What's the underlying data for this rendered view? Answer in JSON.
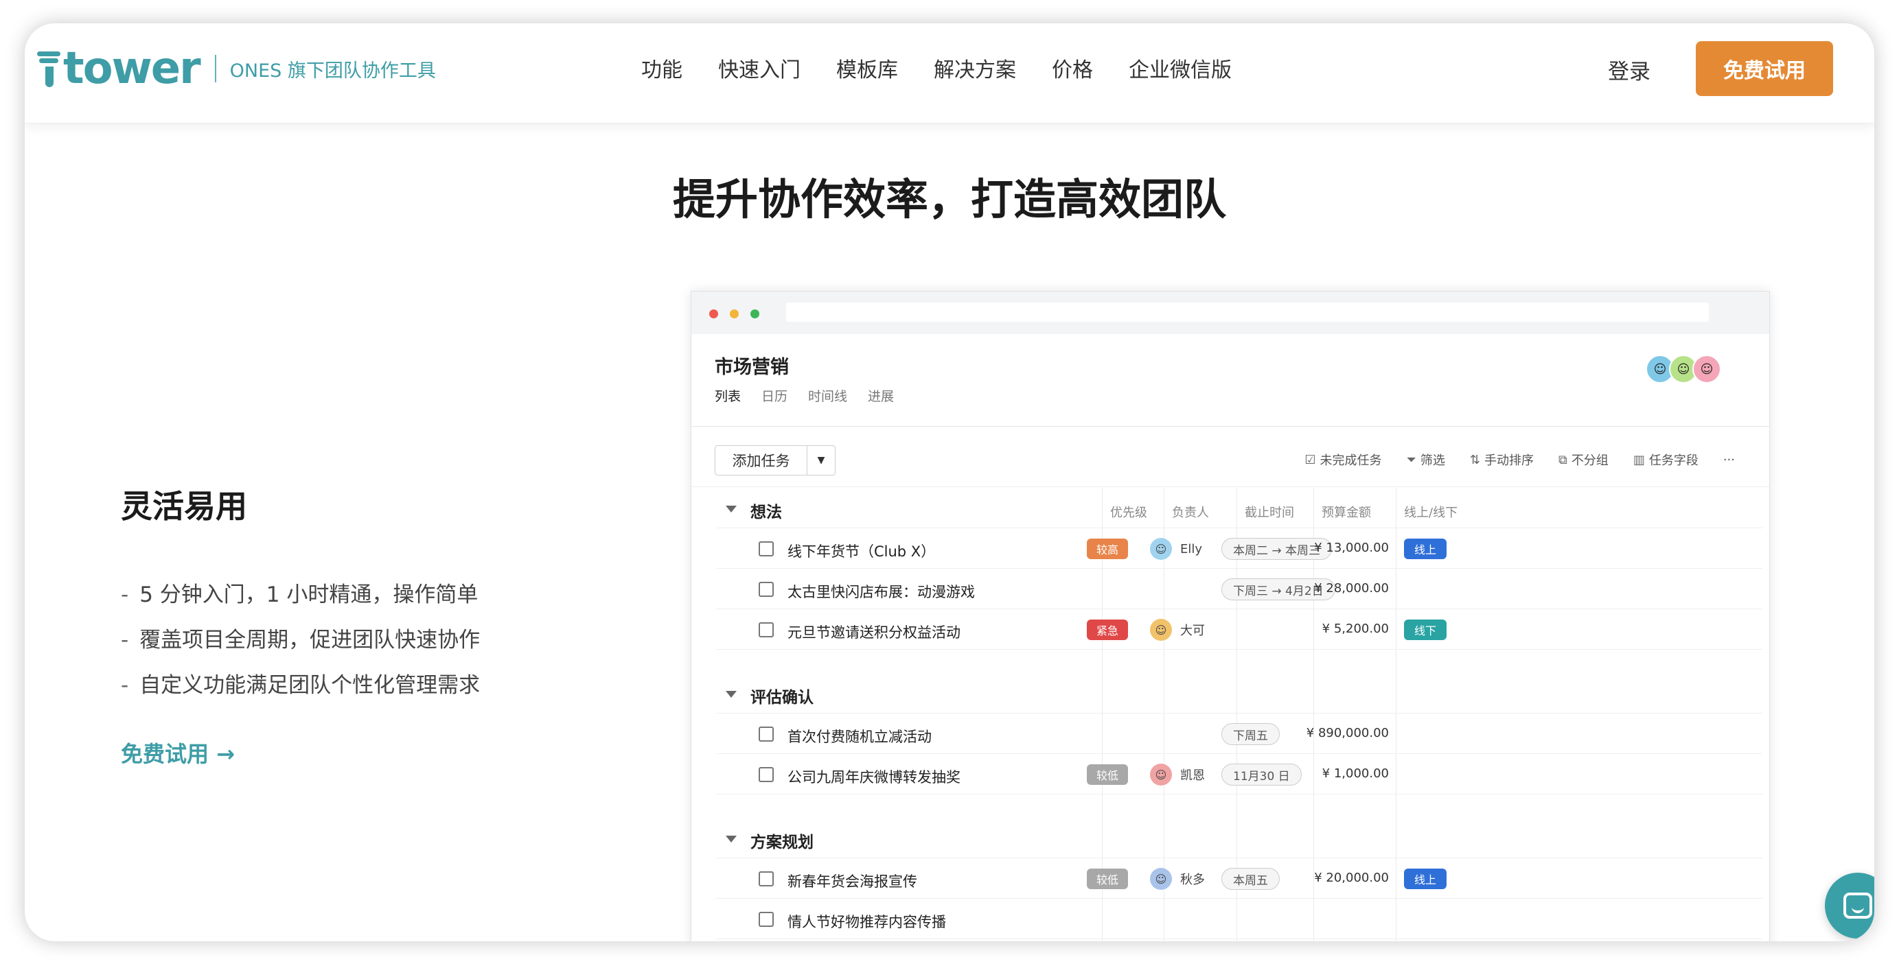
{
  "header": {
    "logo_word": "tower",
    "logo_tagline": "ONES 旗下团队协作工具",
    "nav": [
      "功能",
      "快速入门",
      "模板库",
      "解决方案",
      "价格",
      "企业微信版"
    ],
    "login": "登录",
    "trial_button": "免费试用"
  },
  "hero": {
    "title": "提升协作效率，打造高效团队"
  },
  "feature": {
    "title": "灵活易用",
    "items": [
      "5 分钟入门，1 小时精通，操作简单",
      "覆盖项目全周期，促进团队快速协作",
      "自定义功能满足团队个性化管理需求"
    ],
    "dash": "-",
    "link": "免费试用 →"
  },
  "app": {
    "project_title": "市场营销",
    "views": [
      "列表",
      "日历",
      "时间线",
      "进展"
    ],
    "add_task": "添加任务",
    "toolbar": [
      "未完成任务",
      "筛选",
      "手动排序",
      "不分组",
      "任务字段"
    ],
    "more": "···",
    "columns": [
      "优先级",
      "负责人",
      "截止时间",
      "预算金额",
      "线上/线下"
    ],
    "groups": [
      {
        "name": "想法",
        "tasks": [
          {
            "title": "线下年货节（Club X）",
            "priority": "较高",
            "priority_color": "#e8844a",
            "assignee": "Elly",
            "date": "本周二 → 本周三",
            "budget": "¥ 13,000.00",
            "channel": "线上",
            "channel_color": "#2f6fd8"
          },
          {
            "title": "太古里快闪店布展：动漫游戏",
            "priority": "",
            "assignee": "",
            "date": "下周三 → 4月2日",
            "budget": "¥ 28,000.00",
            "channel": ""
          },
          {
            "title": "元旦节邀请送积分权益活动",
            "priority": "紧急",
            "priority_color": "#e04848",
            "assignee": "大可",
            "date": "",
            "budget": "¥ 5,200.00",
            "channel": "线下",
            "channel_color": "#2aa3a3"
          }
        ]
      },
      {
        "name": "评估确认",
        "tasks": [
          {
            "title": "首次付费随机立减活动",
            "priority": "",
            "assignee": "",
            "date": "下周五",
            "budget": "¥ 890,000.00",
            "channel": ""
          },
          {
            "title": "公司九周年庆微博转发抽奖",
            "priority": "较低",
            "priority_color": "#a8a8a8",
            "assignee": "凯恩",
            "date": "11月30 日",
            "budget": "¥ 1,000.00",
            "channel": ""
          }
        ]
      },
      {
        "name": "方案规划",
        "tasks": [
          {
            "title": "新春年货会海报宣传",
            "priority": "较低",
            "priority_color": "#a8a8a8",
            "assignee": "秋多",
            "date": "本周五",
            "budget": "¥ 20,000.00",
            "channel": "线上",
            "channel_color": "#2f6fd8"
          },
          {
            "title": "情人节好物推荐内容传播",
            "priority": "",
            "assignee": "",
            "date": "",
            "budget": "",
            "channel": ""
          }
        ]
      }
    ]
  },
  "colors": {
    "brand": "#3e9da6",
    "cta": "#e48a35"
  }
}
